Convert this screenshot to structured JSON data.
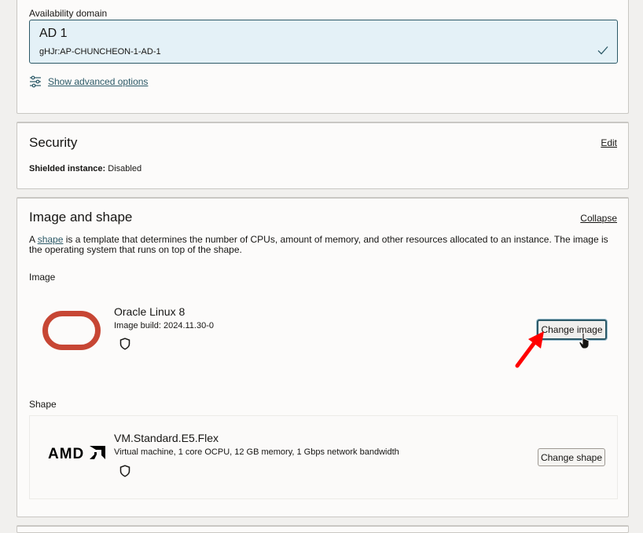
{
  "availability": {
    "label": "Availability domain",
    "selected_title": "AD 1",
    "selected_subtitle": "gHJr:AP-CHUNCHEON-1-AD-1",
    "advanced_link": "Show advanced options"
  },
  "security": {
    "title": "Security",
    "edit_label": "Edit",
    "shielded_label": "Shielded instance:",
    "shielded_value": "Disabled"
  },
  "image_shape": {
    "title": "Image and shape",
    "collapse_label": "Collapse",
    "desc_prefix": "A ",
    "desc_link": "shape",
    "desc_rest": " is a template that determines the number of CPUs, amount of memory, and other resources allocated to an instance. The image is the operating system that runs on top of the shape.",
    "image_label": "Image",
    "image": {
      "name": "Oracle Linux 8",
      "build": "Image build: 2024.11.30-0",
      "button": "Change image"
    },
    "shape_label": "Shape",
    "shape": {
      "logo_text": "AMD",
      "name": "VM.Standard.E5.Flex",
      "details": "Virtual machine, 1 core OCPU, 12 GB memory, 1 Gbps network bandwidth",
      "button": "Change shape"
    }
  },
  "colors": {
    "accent": "#2c5967",
    "oracle_red": "#c74634",
    "annotation_arrow": "#ff0000"
  }
}
